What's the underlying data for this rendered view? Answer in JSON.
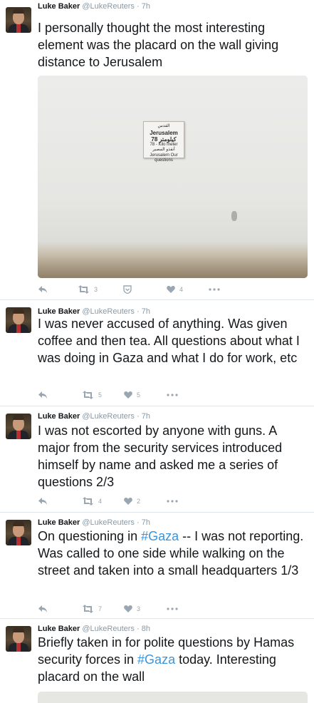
{
  "tweets": [
    {
      "author_name": "Luke Baker",
      "author_handle": "@LukeReuters",
      "separator": "·",
      "time": "7h",
      "text_parts": [
        "I personally thought the most interesting element was the placard on the wall giving distance to Jerusalem"
      ],
      "retweets": "3",
      "likes": "4",
      "media": {
        "plaque": {
          "line1": "القدس",
          "line2": "Jerusalem",
          "line3": "78 كيلومتر",
          "line4": "78 - Kilo meter",
          "line5": "أنقذو المصير",
          "line6": "Jerusalem Our questions"
        }
      }
    },
    {
      "author_name": "Luke Baker",
      "author_handle": "@LukeReuters",
      "separator": "·",
      "time": "7h",
      "text_parts": [
        "I was never accused of anything. Was given coffee and then tea. All questions about what I was doing in Gaza and what I do for work, etc"
      ],
      "retweets": "5",
      "likes": "5"
    },
    {
      "author_name": "Luke Baker",
      "author_handle": "@LukeReuters",
      "separator": "·",
      "time": "7h",
      "text_parts": [
        "I was not escorted by anyone with guns. A major from the security services introduced himself by name and asked me a series of questions 2/3"
      ],
      "retweets": "4",
      "likes": "2"
    },
    {
      "author_name": "Luke Baker",
      "author_handle": "@LukeReuters",
      "separator": "·",
      "time": "7h",
      "text_parts": [
        "On questioning in ",
        "#Gaza",
        " -- I was not reporting. Was called to one side while walking on the street and taken into a small headquarters 1/3"
      ],
      "retweets": "7",
      "likes": "3"
    },
    {
      "author_name": "Luke Baker",
      "author_handle": "@LukeReuters",
      "separator": "·",
      "time": "8h",
      "text_parts": [
        "Briefly taken in for polite questions by Hamas security forces in ",
        "#Gaza",
        " today. Interesting placard on the wall"
      ]
    }
  ],
  "icons": {
    "reply": "reply-icon",
    "retweet": "retweet-icon",
    "moments": "moments-icon",
    "like": "heart-icon",
    "more": "more-icon"
  },
  "colors": {
    "name": "#14171a",
    "meta": "#8899a6",
    "hashtag": "#3b94d9",
    "action": "#9aa7b2",
    "divider": "#e1e8ed"
  }
}
